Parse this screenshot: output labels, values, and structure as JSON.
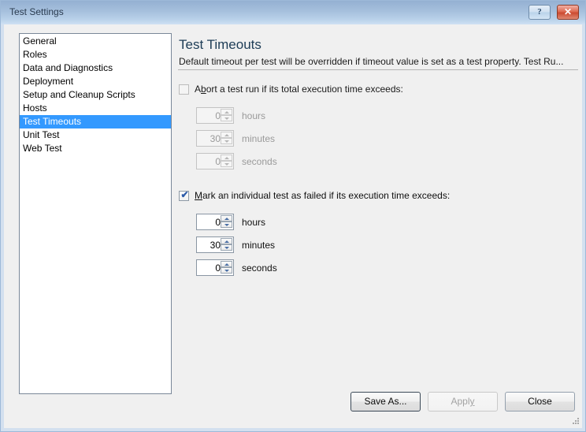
{
  "window": {
    "title": "Test Settings",
    "help_button": "?",
    "close_button": "✕",
    "frame_color": "#9db9d8",
    "titlebar_gradient_top": "#94b0d2",
    "titlebar_gradient_bottom": "#cfe1f3",
    "client_background": "#f0f0f0"
  },
  "sidebar": {
    "selected_index": 6,
    "selection_color": "#3399ff",
    "items": [
      {
        "label": "General",
        "selected": false
      },
      {
        "label": "Roles",
        "selected": false
      },
      {
        "label": "Data and Diagnostics",
        "selected": false
      },
      {
        "label": "Deployment",
        "selected": false
      },
      {
        "label": "Setup and Cleanup Scripts",
        "selected": false
      },
      {
        "label": "Hosts",
        "selected": false
      },
      {
        "label": "Test Timeouts",
        "selected": true
      },
      {
        "label": "Unit Test",
        "selected": false
      },
      {
        "label": "Web Test",
        "selected": false
      }
    ]
  },
  "pane": {
    "title": "Test Timeouts",
    "description": "Default timeout per test will be overridden if timeout value is set as a test property. Test Ru...",
    "sections": [
      {
        "checkbox": {
          "label_before": "A",
          "label_accel": "b",
          "label_after": "ort a test run if its total execution time exceeds:",
          "full_label": "Abort a test run if its total execution time exceeds:",
          "checked": false,
          "enabled": false,
          "tick": ""
        },
        "fields": [
          {
            "value": "0",
            "unit": "hours",
            "enabled": false
          },
          {
            "value": "30",
            "unit": "minutes",
            "enabled": false
          },
          {
            "value": "0",
            "unit": "seconds",
            "enabled": false
          }
        ]
      },
      {
        "checkbox": {
          "label_before": "",
          "label_accel": "M",
          "label_after": "ark an individual test as failed if its execution time exceeds:",
          "full_label": "Mark an individual test as failed if its execution time exceeds:",
          "checked": true,
          "enabled": true,
          "tick": "✔"
        },
        "fields": [
          {
            "value": "0",
            "unit": "hours",
            "enabled": true
          },
          {
            "value": "30",
            "unit": "minutes",
            "enabled": true
          },
          {
            "value": "0",
            "unit": "seconds",
            "enabled": true
          }
        ]
      }
    ]
  },
  "footer": {
    "save_as": {
      "label_before": "S",
      "label_accel": "",
      "label_after": "ave As...",
      "full_label": "Save As...",
      "enabled": true,
      "default": true
    },
    "apply": {
      "label_before": "Appl",
      "label_accel": "y",
      "label_after": "",
      "full_label": "Apply",
      "enabled": false,
      "default": false
    },
    "close": {
      "label_before": "Close",
      "label_accel": "",
      "label_after": "",
      "full_label": "Close",
      "enabled": true,
      "default": false
    }
  }
}
